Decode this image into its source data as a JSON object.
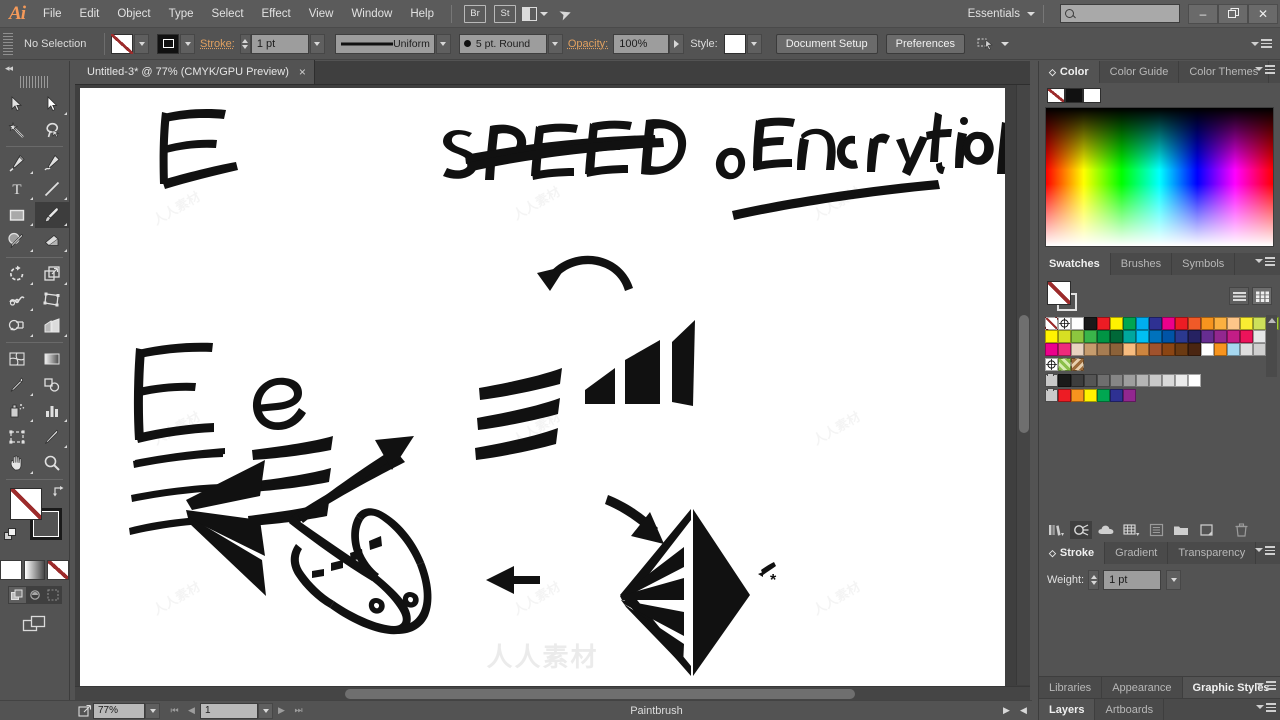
{
  "app": {
    "logo": "Ai",
    "menus": [
      "File",
      "Edit",
      "Object",
      "Type",
      "Select",
      "Effect",
      "View",
      "Window",
      "Help"
    ],
    "bridge_button": "Br",
    "stock_button": "St",
    "arrange_icon": "arrange-documents-icon",
    "rocket_icon": "rocket-icon",
    "workspace": "Essentials",
    "search_placeholder": "",
    "window_minimize": "–",
    "window_restore": "❐",
    "window_close": "✕"
  },
  "control_bar": {
    "selection_status": "No Selection",
    "fill_swatch": "none-fill-swatch",
    "stroke_swatch": "stroke-swatch",
    "stroke_label": "Stroke:",
    "stroke_weight": "1 pt",
    "profile_label": "Uniform",
    "brush_label": "5 pt. Round",
    "opacity_label": "Opacity:",
    "opacity_value": "100%",
    "style_label": "Style:",
    "document_setup": "Document Setup",
    "preferences": "Preferences",
    "align_icon": "align-to-selection-icon"
  },
  "document_tab": {
    "title": "Untitled-3* @ 77% (CMYK/GPU Preview)",
    "close": "×"
  },
  "toolbar": {
    "collapse_icon": "◂◂",
    "tools": [
      {
        "name": "selection-tool",
        "corner": false,
        "selected": false
      },
      {
        "name": "direct-selection-tool",
        "corner": true,
        "selected": false
      },
      {
        "name": "magic-wand-tool",
        "corner": false,
        "selected": false
      },
      {
        "name": "lasso-tool",
        "corner": false,
        "selected": false
      },
      {
        "name": "pen-tool",
        "corner": true,
        "selected": false
      },
      {
        "name": "curvature-tool",
        "corner": false,
        "selected": false
      },
      {
        "name": "type-tool",
        "corner": true,
        "selected": false
      },
      {
        "name": "line-segment-tool",
        "corner": true,
        "selected": false
      },
      {
        "name": "rectangle-tool",
        "corner": true,
        "selected": false
      },
      {
        "name": "paintbrush-tool",
        "corner": true,
        "selected": true
      },
      {
        "name": "shaper-tool",
        "corner": true,
        "selected": false
      },
      {
        "name": "eraser-tool",
        "corner": true,
        "selected": false
      },
      {
        "name": "rotate-tool",
        "corner": true,
        "selected": false
      },
      {
        "name": "scale-tool",
        "corner": true,
        "selected": false
      },
      {
        "name": "width-tool",
        "corner": true,
        "selected": false
      },
      {
        "name": "free-transform-tool",
        "corner": false,
        "selected": false
      },
      {
        "name": "shape-builder-tool",
        "corner": true,
        "selected": false
      },
      {
        "name": "perspective-grid-tool",
        "corner": true,
        "selected": false
      },
      {
        "name": "mesh-tool",
        "corner": false,
        "selected": false
      },
      {
        "name": "gradient-tool",
        "corner": false,
        "selected": false
      },
      {
        "name": "eyedropper-tool",
        "corner": true,
        "selected": false
      },
      {
        "name": "blend-tool",
        "corner": false,
        "selected": false
      },
      {
        "name": "symbol-sprayer-tool",
        "corner": true,
        "selected": false
      },
      {
        "name": "column-graph-tool",
        "corner": true,
        "selected": false
      },
      {
        "name": "artboard-tool",
        "corner": false,
        "selected": false
      },
      {
        "name": "slice-tool",
        "corner": true,
        "selected": false
      },
      {
        "name": "hand-tool",
        "corner": true,
        "selected": false
      },
      {
        "name": "zoom-tool",
        "corner": false,
        "selected": false
      }
    ],
    "fill_swatch": "none-fill",
    "stroke_swatch": "black-stroke",
    "swap_icon": "swap-fill-stroke-icon",
    "default_icon": "default-fill-stroke-icon",
    "color_modes": [
      "color-mode",
      "gradient-mode",
      "none-mode"
    ],
    "draw_modes": [
      "draw-normal",
      "draw-behind",
      "draw-inside"
    ],
    "screen_mode": "change-screen-mode-icon"
  },
  "canvas": {
    "artwork_description": "Hand-drawn brush sketches: letter E shapes, the word SPEED, the word oEncryption, tapered stroke lines, arrows, a triangle fan burst and a faceted diamond shape",
    "labels": {
      "speed": "SPEED",
      "encryption": "oEncryption",
      "letter_e_upper": "E",
      "letter_e_lower": "e"
    },
    "watermark": "人人素材"
  },
  "status_bar": {
    "export_icon": "export-selection-icon",
    "zoom_value": "77%",
    "first_page": "⏮",
    "prev_page": "◀",
    "page_value": "1",
    "next_page": "▶",
    "last_page": "⏭",
    "current_tool": "Paintbrush",
    "expand_arrow": "▶",
    "collapse_arrow": "◀"
  },
  "panels": {
    "color": {
      "tabs": [
        "Color",
        "Color Guide",
        "Color Themes"
      ],
      "active_tab": "Color",
      "swatches": [
        "none",
        "black",
        "white"
      ]
    },
    "swatches": {
      "tabs": [
        "Swatches",
        "Brushes",
        "Symbols"
      ],
      "active_tab": "Swatches",
      "view_list_icon": "list-view-icon",
      "view_grid_icon": "grid-view-icon",
      "rows": [
        [
          "none",
          "registration",
          "#ffffff",
          "#1a1a1a",
          "#ec1c24",
          "#fff200",
          "#00a651",
          "#00aeef",
          "#2e3192",
          "#ec008c",
          "#ed1c24",
          "#f05a28",
          "#f7941e",
          "#fbb040",
          "#fdc689",
          "#f9ed32",
          "#cde05a",
          "#a6ce39"
        ],
        [
          "#fff200",
          "#d7df23",
          "#8dc63f",
          "#39b54a",
          "#009444",
          "#006838",
          "#00a79d",
          "#00bff3",
          "#0072bc",
          "#0054a6",
          "#2b3990",
          "#262262",
          "#662d91",
          "#92278f",
          "#c31d86",
          "#ed135a",
          "#e6e7e8"
        ],
        [
          "#ec008c",
          "#ee2a7b",
          "#e8d3c0",
          "#c69c6d",
          "#a67c52",
          "#8c6239",
          "#f7bc7f",
          "#cd853f",
          "#a0522d",
          "#8b4513",
          "#6b3a12",
          "#4a2511",
          "#ffffff",
          "#f7941e",
          "#a6d8f0",
          "#dedede",
          "#cfcfcf"
        ]
      ],
      "extra_row": [
        "registration-target",
        "pattern-green",
        "pattern-brown"
      ],
      "gray_row": [
        "#1a1a1a",
        "#3d3d3d",
        "#555555",
        "#6e6e6e",
        "#868686",
        "#9e9e9e",
        "#b5b5b5",
        "#c9c9c9",
        "#dadada",
        "#ececec",
        "#ffffff"
      ],
      "bright_row": [
        "#ed1c24",
        "#f7941e",
        "#fff200",
        "#00a651",
        "#2e3192",
        "#92278f"
      ],
      "toolbar_icons": [
        "swatch-libraries-icon",
        "color-groups-icon",
        "libraries-cloud-icon",
        "show-swatch-kinds-icon",
        "swatch-options-icon",
        "new-color-group-icon",
        "new-swatch-icon",
        "delete-swatch-icon"
      ]
    },
    "stroke": {
      "tabs": [
        "Stroke",
        "Gradient",
        "Transparency"
      ],
      "active_tab": "Stroke",
      "weight_label": "Weight:",
      "weight_value": "1 pt"
    },
    "bottom_docks": [
      {
        "tabs": [
          "Libraries",
          "Appearance",
          "Graphic Styles"
        ],
        "active": "Graphic Styles"
      },
      {
        "tabs": [
          "Layers",
          "Artboards"
        ],
        "active": "Layers"
      }
    ]
  }
}
